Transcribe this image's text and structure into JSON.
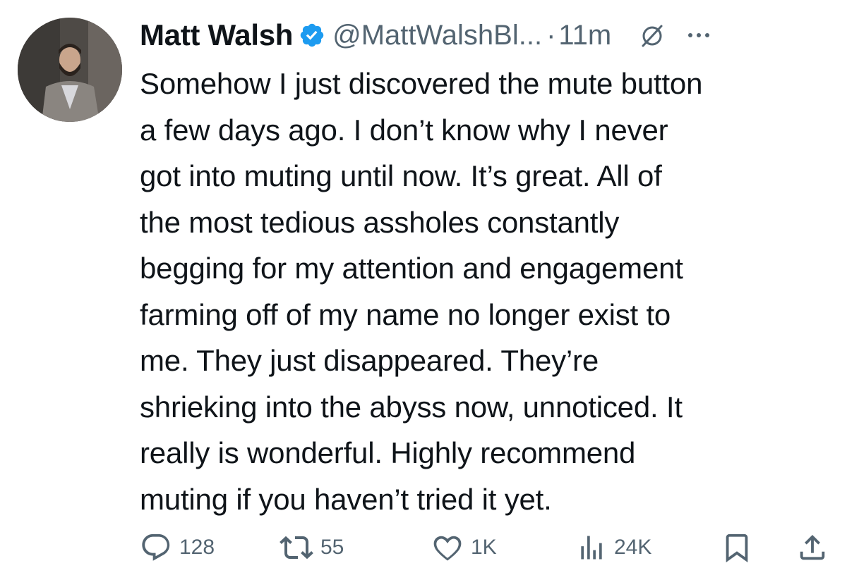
{
  "tweet": {
    "display_name": "Matt Walsh",
    "handle": "@MattWalshBl...",
    "separator": "·",
    "time": "11m",
    "verified_color": "#1d9bf0",
    "icons": {
      "avatar": "profile-photo",
      "verified": "verified-badge-icon",
      "muted": "muted-bell-slash-icon",
      "more": "more-horizontal-icon"
    },
    "lines": [
      "Somehow I just discovered the mute button",
      "a few days ago. I don’t know why I never",
      "got into muting until now. It’s great. All of",
      "the most tedious assholes constantly",
      "begging for my attention and engagement",
      "farming off of my name no longer exist to",
      "me. They just disappeared. They’re",
      "shrieking into the abyss now, unnoticed. It",
      "really is wonderful. Highly recommend",
      "muting if you haven’t tried it yet."
    ],
    "actions": {
      "replies": "128",
      "retweets": "55",
      "likes": "1K",
      "views": "24K"
    }
  }
}
